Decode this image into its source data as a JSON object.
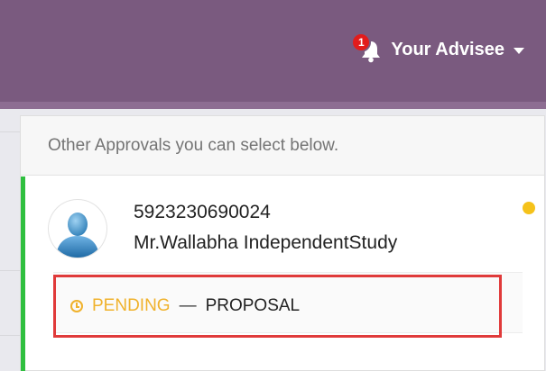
{
  "navbar": {
    "notification_count": "1",
    "user_menu_label": "Your Advisee",
    "background_color": "#7a5a7f"
  },
  "dropdown": {
    "header": "Other Approvals you can select below.",
    "items": [
      {
        "id": "5923230690024",
        "name": "Mr.Wallabha IndependentStudy",
        "status": "PENDING",
        "separator": "—",
        "stage": "PROPOSAL",
        "status_color": "#f0b22c",
        "accent_color": "#2fbf3f",
        "unread": true
      }
    ]
  },
  "icons": {
    "bell": "bell-icon",
    "caret": "chevron-down-icon",
    "avatar": "user-avatar-icon",
    "status": "clock-icon"
  }
}
